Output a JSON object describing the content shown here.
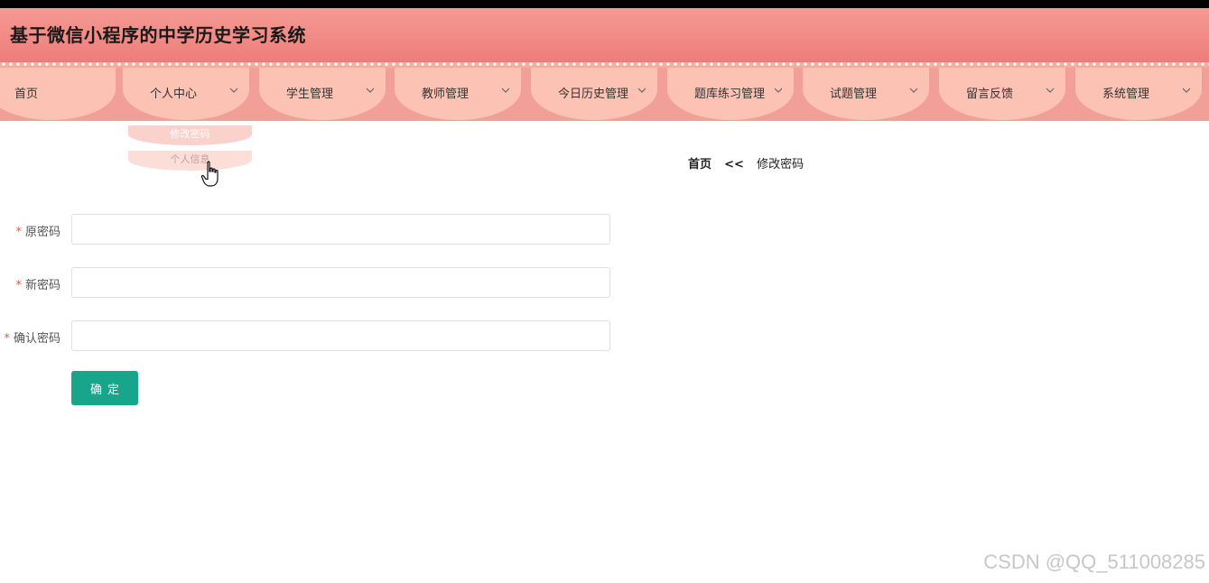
{
  "app": {
    "title": "基于微信小程序的中学历史学习系统"
  },
  "nav": {
    "items": [
      {
        "label": "首页",
        "has_dropdown": false
      },
      {
        "label": "个人中心",
        "has_dropdown": true
      },
      {
        "label": "学生管理",
        "has_dropdown": true
      },
      {
        "label": "教师管理",
        "has_dropdown": true
      },
      {
        "label": "今日历史管理",
        "has_dropdown": true
      },
      {
        "label": "题库练习管理",
        "has_dropdown": true
      },
      {
        "label": "试题管理",
        "has_dropdown": true
      },
      {
        "label": "留言反馈",
        "has_dropdown": true
      },
      {
        "label": "系统管理",
        "has_dropdown": true
      }
    ],
    "dropdown": {
      "items": [
        "修改密码",
        "个人信息"
      ]
    }
  },
  "breadcrumb": {
    "home": "首页",
    "separator": "<<",
    "current": "修改密码"
  },
  "form": {
    "required_mark": "*",
    "fields": [
      {
        "label": "原密码",
        "value": ""
      },
      {
        "label": "新密码",
        "value": ""
      },
      {
        "label": "确认密码",
        "value": ""
      }
    ],
    "submit_label": "确定"
  },
  "watermark": {
    "text": "CSDN @QQ_511008285"
  },
  "colors": {
    "header": "#f28a85",
    "nav_tab": "#fcc3b5",
    "primary_button": "#17a58c",
    "required": "#e05a4c"
  }
}
